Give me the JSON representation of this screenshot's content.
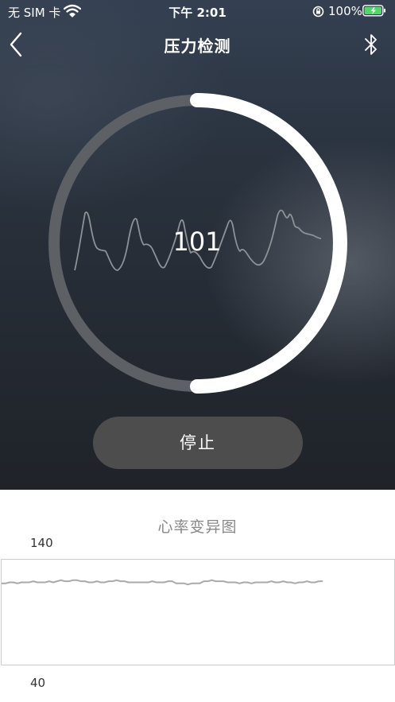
{
  "status_bar": {
    "carrier": "无 SIM 卡",
    "time": "下午 2:01",
    "battery": "100%"
  },
  "nav": {
    "title": "压力检测",
    "back_icon": "chevron-left-icon",
    "right_icon": "bluetooth-icon"
  },
  "gauge": {
    "value": "101",
    "progress": 0.5
  },
  "action": {
    "stop_label": "停止"
  },
  "hrv_chart": {
    "title": "心率变异图",
    "y_max_label": "140",
    "y_min_label": "40"
  },
  "chart_data": {
    "type": "line",
    "title": "心率变异图",
    "ylim": [
      40,
      140
    ],
    "x_capacity": 100,
    "series": [
      {
        "color": "#aaaaaa",
        "values": [
          117,
          117,
          118,
          118,
          117,
          118,
          118,
          118,
          119,
          118,
          118,
          118,
          119,
          118,
          119,
          120,
          119,
          119,
          120,
          120,
          119,
          119,
          118,
          118,
          119,
          118,
          118,
          119,
          119,
          120,
          119,
          119,
          118,
          118,
          118,
          118,
          118,
          118,
          119,
          118,
          118,
          118,
          119,
          119,
          117,
          117,
          117,
          116,
          117,
          117,
          117,
          119,
          119,
          120,
          119,
          119,
          119,
          118,
          118,
          118,
          117,
          118,
          118,
          117,
          118,
          118,
          118,
          118,
          119,
          118,
          118,
          119,
          118,
          118,
          117,
          118,
          118,
          119,
          118,
          118,
          119,
          119
        ]
      }
    ]
  },
  "colors": {
    "ring_track": "#5d6166",
    "ring_progress": "#ffffff",
    "waveform": "#8e9297",
    "button_bg": "#4d4d4d",
    "chart_line": "#aaaaaa",
    "chart_border": "#cccccc",
    "battery_fill": "#4cd964"
  }
}
